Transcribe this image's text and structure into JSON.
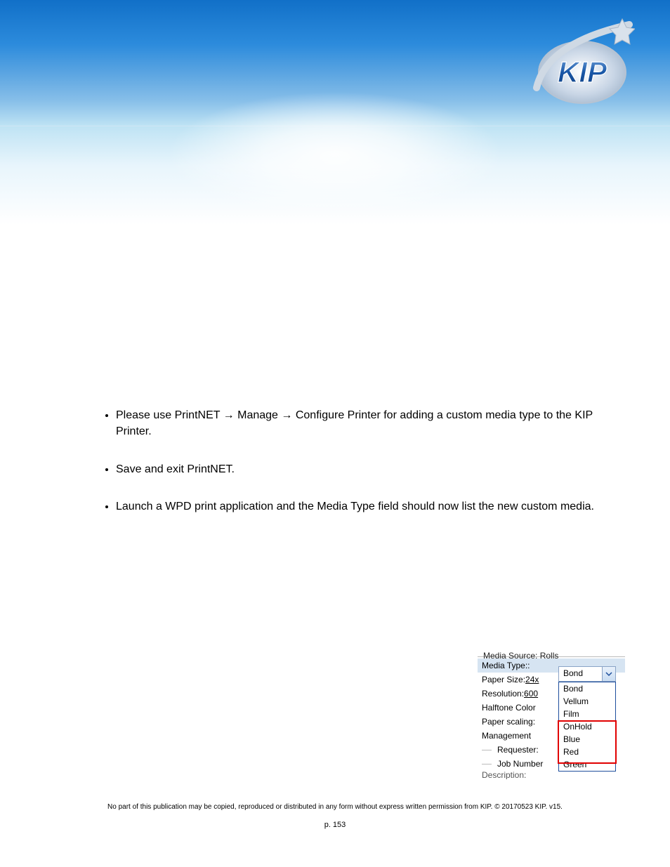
{
  "brand": "KIP",
  "content": {
    "bullets": [
      {
        "pre": "Please use PrintNET",
        "arrow1": "→",
        "mid1": "Manage ",
        "arrow2": "→",
        "mid2": "Configure Printer for adding a custom media type to the KIP Printer."
      },
      {
        "text": "Save and exit PrintNET."
      },
      {
        "text": "Launch a WPD print application and the Media Type field should now list the new custom media."
      }
    ]
  },
  "shot": {
    "cut_label": "Media Source:",
    "cut_value": "Rolls",
    "rows": [
      {
        "label": "Media Type:: ",
        "highlight": true
      },
      {
        "label": "Paper Size: ",
        "value": "24x",
        "link": true
      },
      {
        "label": "Resolution: ",
        "value": "600",
        "link": true
      },
      {
        "label": "Halftone Color "
      },
      {
        "label": "Paper scaling: "
      },
      {
        "label": "Management"
      },
      {
        "label": "Requester:",
        "indent": true
      },
      {
        "label": "Job Number",
        "indent": true
      }
    ],
    "desc_cut": "Description:",
    "dd_value": "Bond",
    "dd_options": [
      "Bond",
      "Vellum",
      "Film",
      "OnHold",
      "Blue",
      "Red",
      "Green"
    ]
  },
  "footer": {
    "line": "No part of this publication may be copied, reproduced or distributed in any form without express written permission from KIP. © 20170523 KIP. v15.",
    "page": "p. 153"
  }
}
